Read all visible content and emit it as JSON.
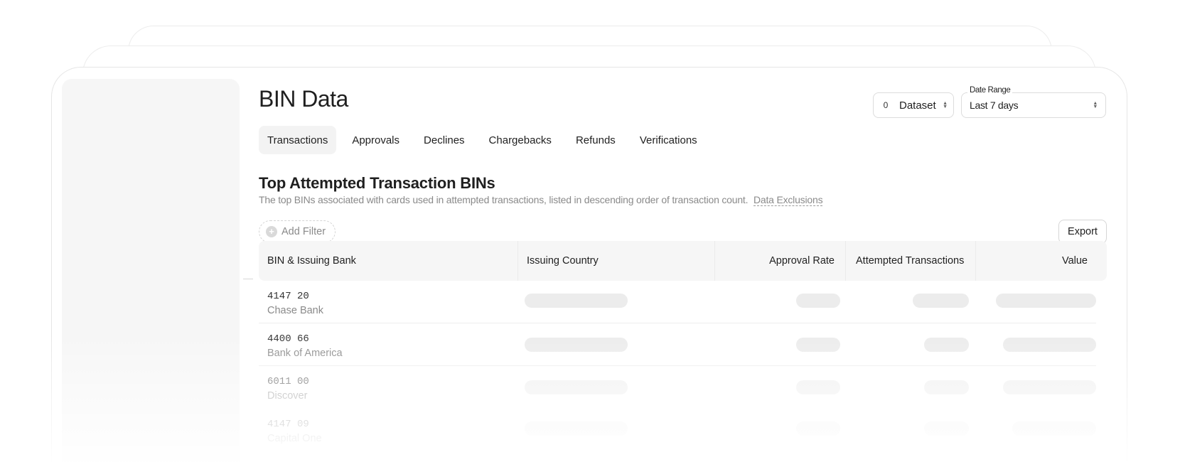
{
  "page": {
    "title": "BIN Data"
  },
  "toolbar": {
    "dataset_count": "0",
    "dataset_label": "Dataset",
    "date_range_label": "Date Range",
    "date_range_value": "Last 7 days"
  },
  "tabs": [
    {
      "label": "Transactions",
      "active": true
    },
    {
      "label": "Approvals",
      "active": false
    },
    {
      "label": "Declines",
      "active": false
    },
    {
      "label": "Chargebacks",
      "active": false
    },
    {
      "label": "Refunds",
      "active": false
    },
    {
      "label": "Verifications",
      "active": false
    }
  ],
  "section": {
    "title": "Top Attempted Transaction BINs",
    "description": "The top BINs associated with cards used in attempted transactions, listed in descending order of transaction count.",
    "link_label": "Data Exclusions"
  },
  "filters": {
    "add_filter_label": "Add Filter",
    "add_icon": "plus-circle-icon"
  },
  "actions": {
    "export_label": "Export"
  },
  "table": {
    "columns": [
      "BIN & Issuing Bank",
      "Issuing Country",
      "Approval Rate",
      "Attempted Transactions",
      "Value"
    ],
    "rows": [
      {
        "bin": "4147 20",
        "bank": "Chase Bank"
      },
      {
        "bin": "4400 66",
        "bank": "Bank of America"
      },
      {
        "bin": "6011 00",
        "bank": "Discover"
      },
      {
        "bin": "4147 09",
        "bank": "Capital One"
      }
    ]
  },
  "colors": {
    "skeleton": "#ececec",
    "header_bg": "#f6f6f6",
    "sidebar_bg": "#f6f6f6",
    "muted_text": "#8a8a8a"
  }
}
